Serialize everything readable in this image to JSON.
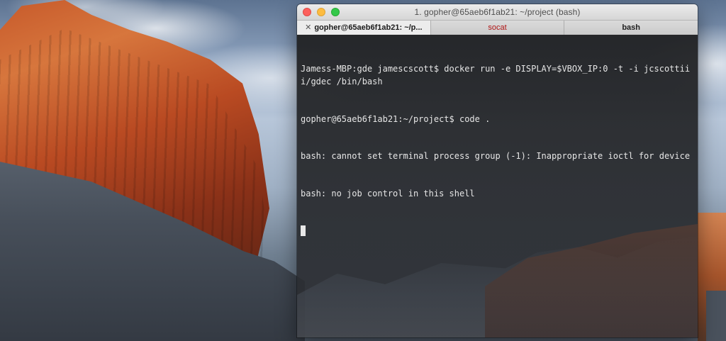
{
  "window": {
    "title": "1. gopher@65aeb6f1ab21: ~/project (bash)"
  },
  "tabs": [
    {
      "label": "gopher@65aeb6f1ab21: ~/p...",
      "close": "✕",
      "active": true
    },
    {
      "label": "socat",
      "active": false
    },
    {
      "label": "bash",
      "active": false
    }
  ],
  "terminal": {
    "lines": [
      "Jamess-MBP:gde jamescscott$ docker run -e DISPLAY=$VBOX_IP:0 -t -i jcscottiii/gdec /bin/bash",
      "gopher@65aeb6f1ab21:~/project$ code .",
      "bash: cannot set terminal process group (-1): Inappropriate ioctl for device",
      "bash: no job control in this shell"
    ]
  },
  "colors": {
    "close": "#fc605c",
    "minimize": "#fdbc40",
    "maximize": "#34c84a",
    "alert_tab": "#b01616"
  },
  "icons": [
    "close-icon",
    "minimize-icon",
    "maximize-icon"
  ]
}
